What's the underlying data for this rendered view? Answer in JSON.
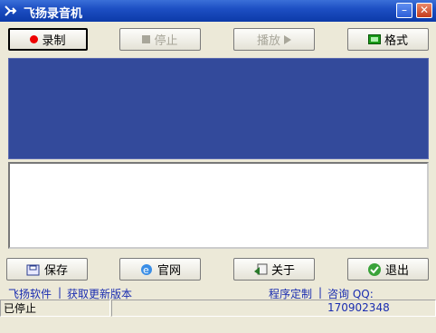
{
  "window": {
    "title": "飞扬录音机",
    "minimize_symbol": "–",
    "close_symbol": "✕"
  },
  "toolbar": {
    "record_label": "录制",
    "stop_label": "停止",
    "play_label": "播放",
    "format_label": "格式"
  },
  "actions": {
    "save_label": "保存",
    "website_label": "官网",
    "about_label": "关于",
    "exit_label": "退出"
  },
  "links": {
    "software": "飞扬软件",
    "separator1": "|",
    "update": "获取更新版本",
    "custom": "程序定制",
    "separator2": "|",
    "consult": "咨询 QQ: 170902348"
  },
  "status": {
    "state": "已停止",
    "info": ""
  },
  "colors": {
    "display_panel": "#334a9b",
    "title_bar": "#1d4fc4",
    "record_dot": "#e00000"
  }
}
